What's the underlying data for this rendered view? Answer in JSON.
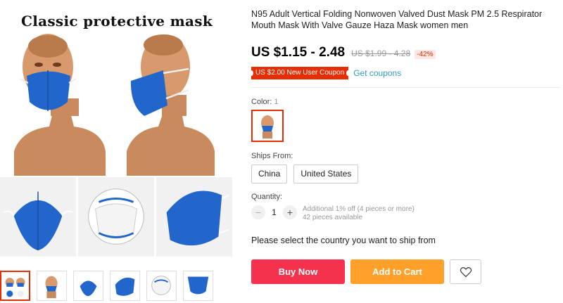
{
  "gallery": {
    "headline": "Classic protective mask"
  },
  "product": {
    "title": "N95 Adult Vertical Folding Nonwoven Valved Dust Mask PM 2.5 Respirator Mouth Mask With Valve Gauze Haza Mask women men",
    "price": "US $1.15 - 2.48",
    "old_price": "US $1.99 - 4.28",
    "discount": "-42%",
    "coupon": "US $2.00 New User Coupon",
    "get_coupons": "Get coupons"
  },
  "color": {
    "label": "Color:",
    "selected": "1"
  },
  "ships_from": {
    "label": "Ships From:",
    "options": [
      "China",
      "United States"
    ]
  },
  "quantity": {
    "label": "Quantity:",
    "value": "1",
    "minus": "−",
    "plus": "+",
    "note_line1": "Additional 1% off (4 pieces or more)",
    "note_line2": "42 pieces available"
  },
  "message": "Please select the country you want to ship from",
  "actions": {
    "buy_now": "Buy Now",
    "add_to_cart": "Add to Cart"
  },
  "colors": {
    "mask_blue": "#2266cc",
    "accent_red": "#e62e04",
    "buy_now": "#f5324e",
    "add_cart": "#fea029",
    "link": "#2e9cc3"
  }
}
